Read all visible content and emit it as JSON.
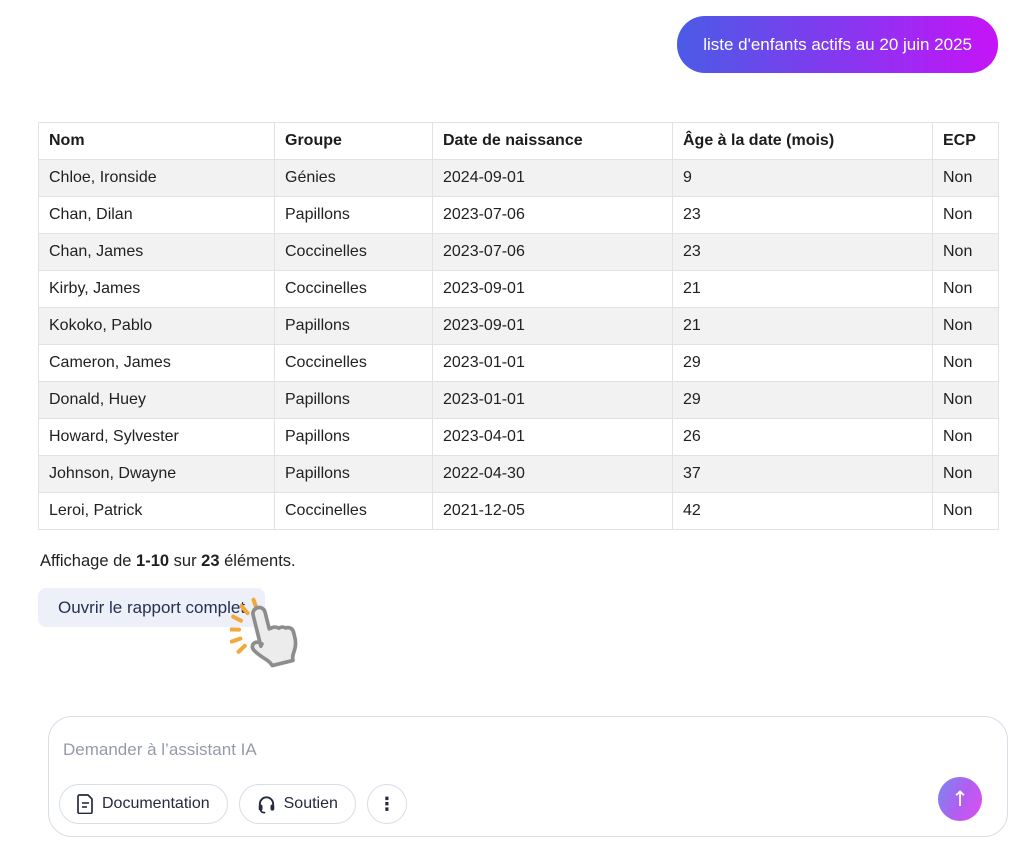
{
  "chat": {
    "user_message": "liste d'enfants actifs au 20 juin 2025"
  },
  "table": {
    "columns": [
      "Nom",
      "Groupe",
      "Date de naissance",
      "Âge à la date (mois)",
      "ECP"
    ],
    "rows": [
      [
        "Chloe, Ironside",
        "Génies",
        "2024-09-01",
        "9",
        "Non"
      ],
      [
        "Chan, Dilan",
        "Papillons",
        "2023-07-06",
        "23",
        "Non"
      ],
      [
        "Chan, James",
        "Coccinelles",
        "2023-07-06",
        "23",
        "Non"
      ],
      [
        "Kirby, James",
        "Coccinelles",
        "2023-09-01",
        "21",
        "Non"
      ],
      [
        "Kokoko, Pablo",
        "Papillons",
        "2023-09-01",
        "21",
        "Non"
      ],
      [
        "Cameron, James",
        "Coccinelles",
        "2023-01-01",
        "29",
        "Non"
      ],
      [
        "Donald, Huey",
        "Papillons",
        "2023-01-01",
        "29",
        "Non"
      ],
      [
        "Howard, Sylvester",
        "Papillons",
        "2023-04-01",
        "26",
        "Non"
      ],
      [
        "Johnson, Dwayne",
        "Papillons",
        "2022-04-30",
        "37",
        "Non"
      ],
      [
        "Leroi, Patrick",
        "Coccinelles",
        "2021-12-05",
        "42",
        "Non"
      ]
    ]
  },
  "pagination": {
    "prefix": "Affichage de ",
    "range": "1-10",
    "middle": " sur ",
    "total": "23",
    "suffix": " éléments."
  },
  "report_button": {
    "label": "Ouvrir le rapport complet"
  },
  "composer": {
    "placeholder": "Demander à l’assistant IA",
    "documentation_label": "Documentation",
    "support_label": "Soutien",
    "more_label": "⋮",
    "send_icon": "↑"
  },
  "colors": {
    "bubble_gradient_start": "#4b5be6",
    "bubble_gradient_end": "#c614f8",
    "send_gradient_start": "#8481ee",
    "send_gradient_end": "#da4ff2",
    "row_alt": "#f2f2f2",
    "table_border": "#e2e2e2",
    "report_button_bg": "#eef0f9",
    "click_rays": "#f2a93c"
  }
}
